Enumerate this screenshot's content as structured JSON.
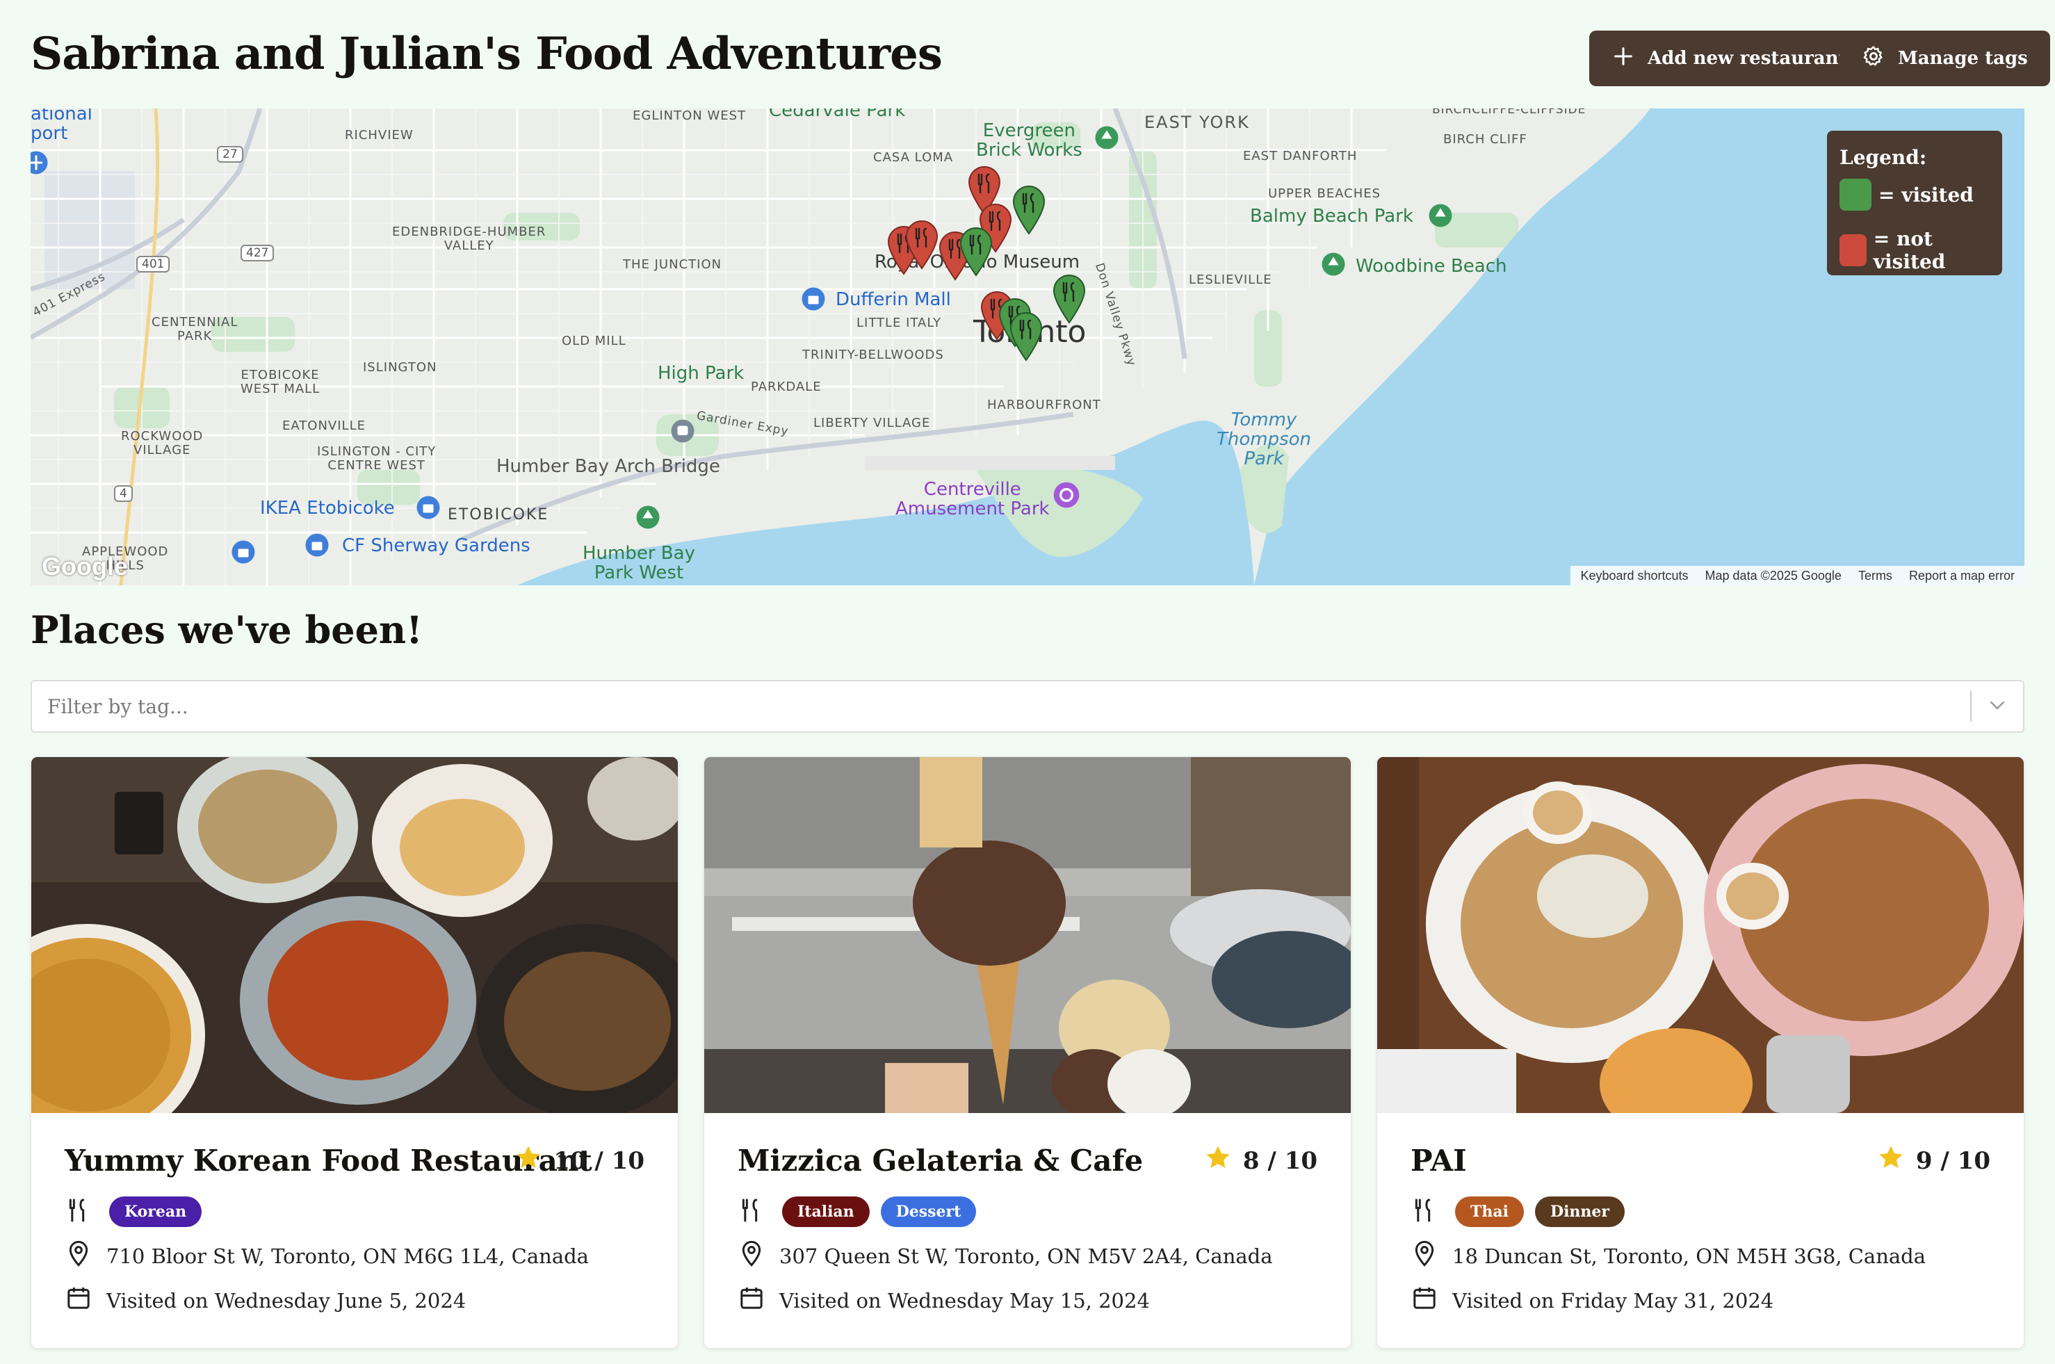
{
  "header": {
    "title": "Sabrina and Julian's Food Adventures",
    "add_label": "Add new restaurant",
    "manage_label": "Manage tags"
  },
  "map": {
    "labels": {
      "national_port": "ational\nport",
      "richview": "RICHVIEW",
      "eglinton_west": "EGLINTON WEST",
      "cedarvale": "Cedarvale Park",
      "casa_loma": "CASA LOMA",
      "evergreen": "Evergreen\nBrick Works",
      "east_york": "EAST YORK",
      "birchcliffe": "BIRCHCLIFFE-CLIFFSIDE",
      "birch_cliff": "BIRCH CLIFF",
      "east_danforth": "EAST DANFORTH",
      "upper_beaches": "UPPER BEACHES",
      "balmy_beach": "Balmy Beach Park",
      "woodbine": "Woodbine Beach",
      "leslieville": "LESLIEVILLE",
      "dvp": "Don Valley Pkwy",
      "edenbridge": "EDENBRIDGE-HUMBER\nVALLEY",
      "junction": "THE JUNCTION",
      "rom": "Royal Ontario Museum",
      "dufferin": "Dufferin Mall",
      "little_italy": "LITTLE ITALY",
      "toronto": "Toronto",
      "trinity": "TRINITY-BELLWOODS",
      "centennial": "CENTENNIAL\nPARK",
      "express": "401 Express",
      "old_mill": "OLD MILL",
      "islington": "ISLINGTON",
      "etobicoke_west_mall": "ETOBICOKE\nWEST MALL",
      "high_park": "High Park",
      "parkdale": "PARKDALE",
      "eatonville": "EATONVILLE",
      "gardiner": "Gardiner Expy",
      "liberty": "LIBERTY VILLAGE",
      "harbourfront": "HARBOURFRONT",
      "tommy": "Tommy\nThompson\nPark",
      "rockwood": "ROCKWOOD\nVILLAGE",
      "islington_city": "ISLINGTON - CITY\nCENTRE WEST",
      "humber_arch": "Humber Bay Arch Bridge",
      "ikea": "IKEA Etobicoke",
      "etobicoke": "ETOBICOKE",
      "centreville": "Centreville\nAmusement Park",
      "applewood": "APPLEWOOD\nHILLS",
      "sherway": "CF Sherway Gardens",
      "humber_bay": "Humber Bay\nPark West",
      "shield_27": "27",
      "shield_427": "427",
      "shield_401": "401",
      "shield_4": "4"
    },
    "footer": {
      "shortcuts": "Keyboard shortcuts",
      "data": "Map data ©2025 Google",
      "terms": "Terms",
      "report": "Report a map error"
    },
    "logo": "Google",
    "legend": {
      "title": "Legend:",
      "visited": "= visited",
      "not_visited": "= not visited",
      "visited_color": "#4a9a4a",
      "not_visited_color": "#cc4a3c"
    },
    "pins": [
      {
        "status": "not_visited"
      },
      {
        "status": "not_visited"
      },
      {
        "status": "not_visited"
      },
      {
        "status": "visited"
      },
      {
        "status": "not_visited"
      },
      {
        "status": "not_visited"
      },
      {
        "status": "visited"
      },
      {
        "status": "visited"
      },
      {
        "status": "not_visited"
      },
      {
        "status": "visited"
      },
      {
        "status": "visited"
      }
    ]
  },
  "section": {
    "title": "Places we've been!",
    "filter_placeholder": "Filter by tag..."
  },
  "cards": [
    {
      "name": "Yummy Korean Food Restaurant",
      "rating": "10 / 10",
      "tags": [
        {
          "label": "Korean",
          "color": "#4b1fa8"
        }
      ],
      "address": "710 Bloor St W, Toronto, ON M6G 1L4, Canada",
      "visited": "Visited on Wednesday June 5, 2024"
    },
    {
      "name": "Mizzica Gelateria & Cafe",
      "rating": "8 / 10",
      "tags": [
        {
          "label": "Italian",
          "color": "#6b1010"
        },
        {
          "label": "Dessert",
          "color": "#3b6fe0"
        }
      ],
      "address": "307 Queen St W, Toronto, ON M5V 2A4, Canada",
      "visited": "Visited on Wednesday May 15, 2024"
    },
    {
      "name": "PAI",
      "rating": "9 / 10",
      "tags": [
        {
          "label": "Thai",
          "color": "#b5581f"
        },
        {
          "label": "Dinner",
          "color": "#5a3a1e"
        }
      ],
      "address": "18 Duncan St, Toronto, ON M5H 3G8, Canada",
      "visited": "Visited on Friday May 31, 2024"
    }
  ],
  "colors": {
    "brand_button": "#4a3a2f",
    "page_background": "#f1fbf3",
    "water": "#a6d7ee",
    "star": "#f2c21b"
  }
}
